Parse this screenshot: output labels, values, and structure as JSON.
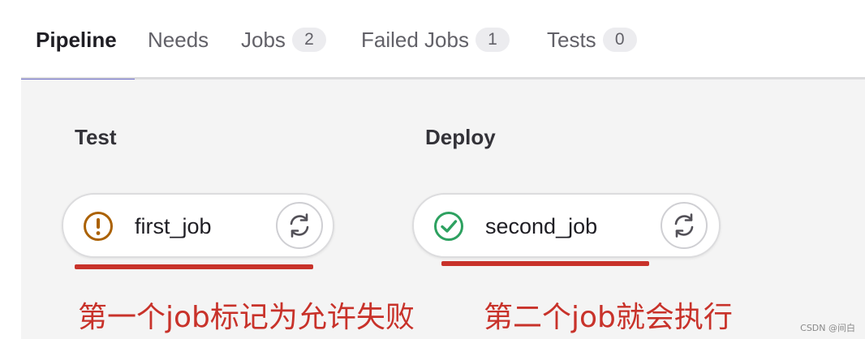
{
  "tabs": [
    {
      "label": "Pipeline",
      "badge": null,
      "active": true
    },
    {
      "label": "Needs",
      "badge": null,
      "active": false
    },
    {
      "label": "Jobs",
      "badge": "2",
      "active": false
    },
    {
      "label": "Failed Jobs",
      "badge": "1",
      "active": false
    },
    {
      "label": "Tests",
      "badge": "0",
      "active": false
    }
  ],
  "stages": [
    {
      "title": "Test",
      "job": {
        "name": "first_job",
        "status": "warning",
        "status_icon": "warning-icon",
        "action_icon": "retry-icon"
      }
    },
    {
      "title": "Deploy",
      "job": {
        "name": "second_job",
        "status": "success",
        "status_icon": "success-check-icon",
        "action_icon": "retry-icon"
      }
    }
  ],
  "annotations": {
    "left": "第一个job标记为允许失败",
    "right": "第二个job就会执行"
  },
  "watermark": "CSDN @间白",
  "colors": {
    "active_tab_underline": "#6666c4",
    "warning": "#ab6100",
    "success": "#2da160",
    "annotation_red": "#c8322a"
  }
}
